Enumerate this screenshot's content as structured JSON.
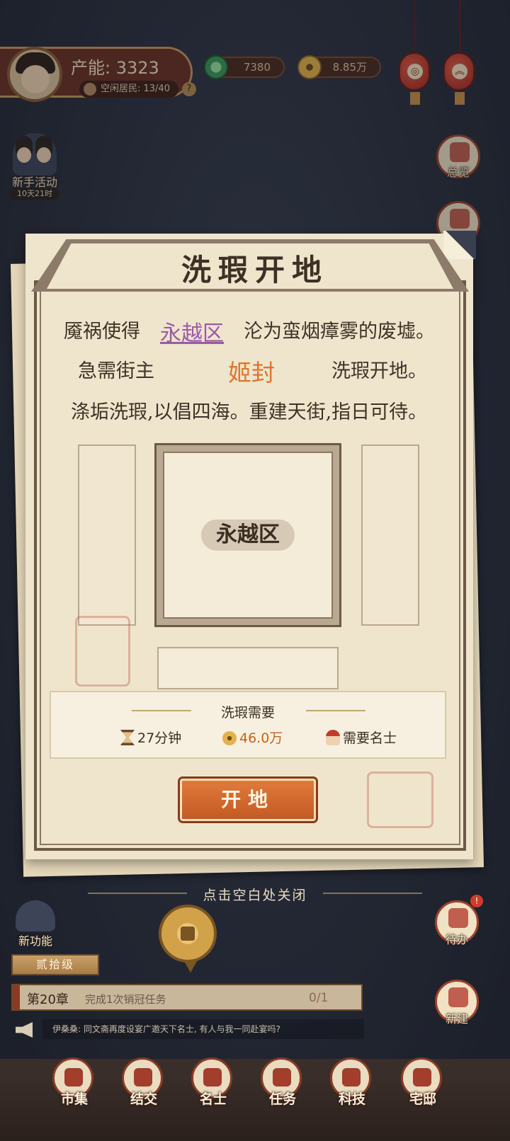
{
  "player": {
    "power_label": "产能: 3323",
    "idle_residents": "空闲居民: 13/40",
    "help": "?"
  },
  "currencies": {
    "jade": "7380",
    "coin": "8.85万"
  },
  "lanterns": [
    {
      "icon": "settings-icon",
      "glyph": "◎"
    },
    {
      "icon": "collapse-up-icon",
      "glyph": "︽"
    }
  ],
  "left_side": {
    "novice_label": "新手活动",
    "novice_timer": "10天21时"
  },
  "right_side": {
    "overview_label": "总览"
  },
  "modal": {
    "title": "洗瑕开地",
    "line1_prefix": "魇祸使得",
    "zone_link": "永越区",
    "line1_suffix": "沦为蛮烟瘴雾的废墟。",
    "line2_prefix": "急需街主",
    "lord_name": "姬封",
    "line2_suffix": "洗瑕开地。",
    "line3": "涤垢洗瑕,以倡四海。重建天街,指日可待。",
    "zone_tag": "永越区",
    "requirements": {
      "title": "洗瑕需要",
      "time": "27分钟",
      "cost": "46.0万",
      "need": "需要名士"
    },
    "start_button": "开地",
    "close_hint": "点击空白处关闭"
  },
  "hud": {
    "new_function_label": "新功能",
    "rank": "贰拾级",
    "chapter": "第20章",
    "chapter_task": "完成1次销冠任务",
    "chapter_progress": "0/1",
    "chat": "伊桑桑: 同文斋再度设宴广邀天下名士, 有人与我一同赴宴吗?",
    "pending_label": "待办",
    "pending_badge": "!",
    "build_label": "新建"
  },
  "nav": [
    {
      "label": "市集",
      "icon": "market-icon"
    },
    {
      "label": "结交",
      "icon": "cards-icon"
    },
    {
      "label": "名士",
      "icon": "scholar-icon"
    },
    {
      "label": "任务",
      "icon": "task-icon"
    },
    {
      "label": "科技",
      "icon": "tech-icon"
    },
    {
      "label": "宅邸",
      "icon": "mansion-icon"
    }
  ],
  "colors": {
    "accent": "#c45a24",
    "zone_link": "#9a5aa8",
    "lord_name": "#e0742a",
    "cost": "#c8641a"
  }
}
